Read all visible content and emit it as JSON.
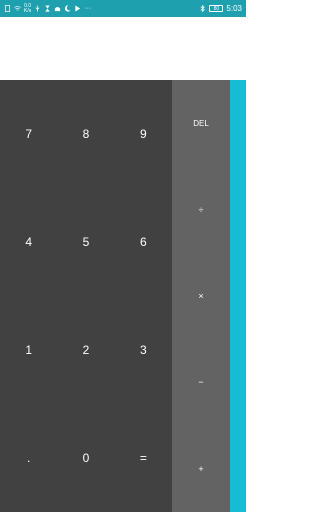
{
  "status_bar": {
    "speed_value": "0.0",
    "speed_unit": "K/s",
    "battery": "80",
    "time": "5:03",
    "more": "···",
    "background": "#1fa0ae",
    "icons": [
      "document-icon",
      "wifi-icon",
      "usb-icon",
      "hourglass-icon",
      "android-icon",
      "moon-icon",
      "play-icon",
      "bluetooth-icon",
      "battery-icon"
    ]
  },
  "display": {
    "formula": "",
    "result": ""
  },
  "keypad": {
    "keys": [
      "7",
      "8",
      "9",
      "4",
      "5",
      "6",
      "1",
      "2",
      "3",
      ".",
      "0",
      "="
    ],
    "background": "#414141"
  },
  "operators": {
    "keys": [
      "DEL",
      "÷",
      "×",
      "−",
      "+"
    ],
    "background": "#636363"
  },
  "advanced_panel": {
    "color": "#16bcd4"
  }
}
